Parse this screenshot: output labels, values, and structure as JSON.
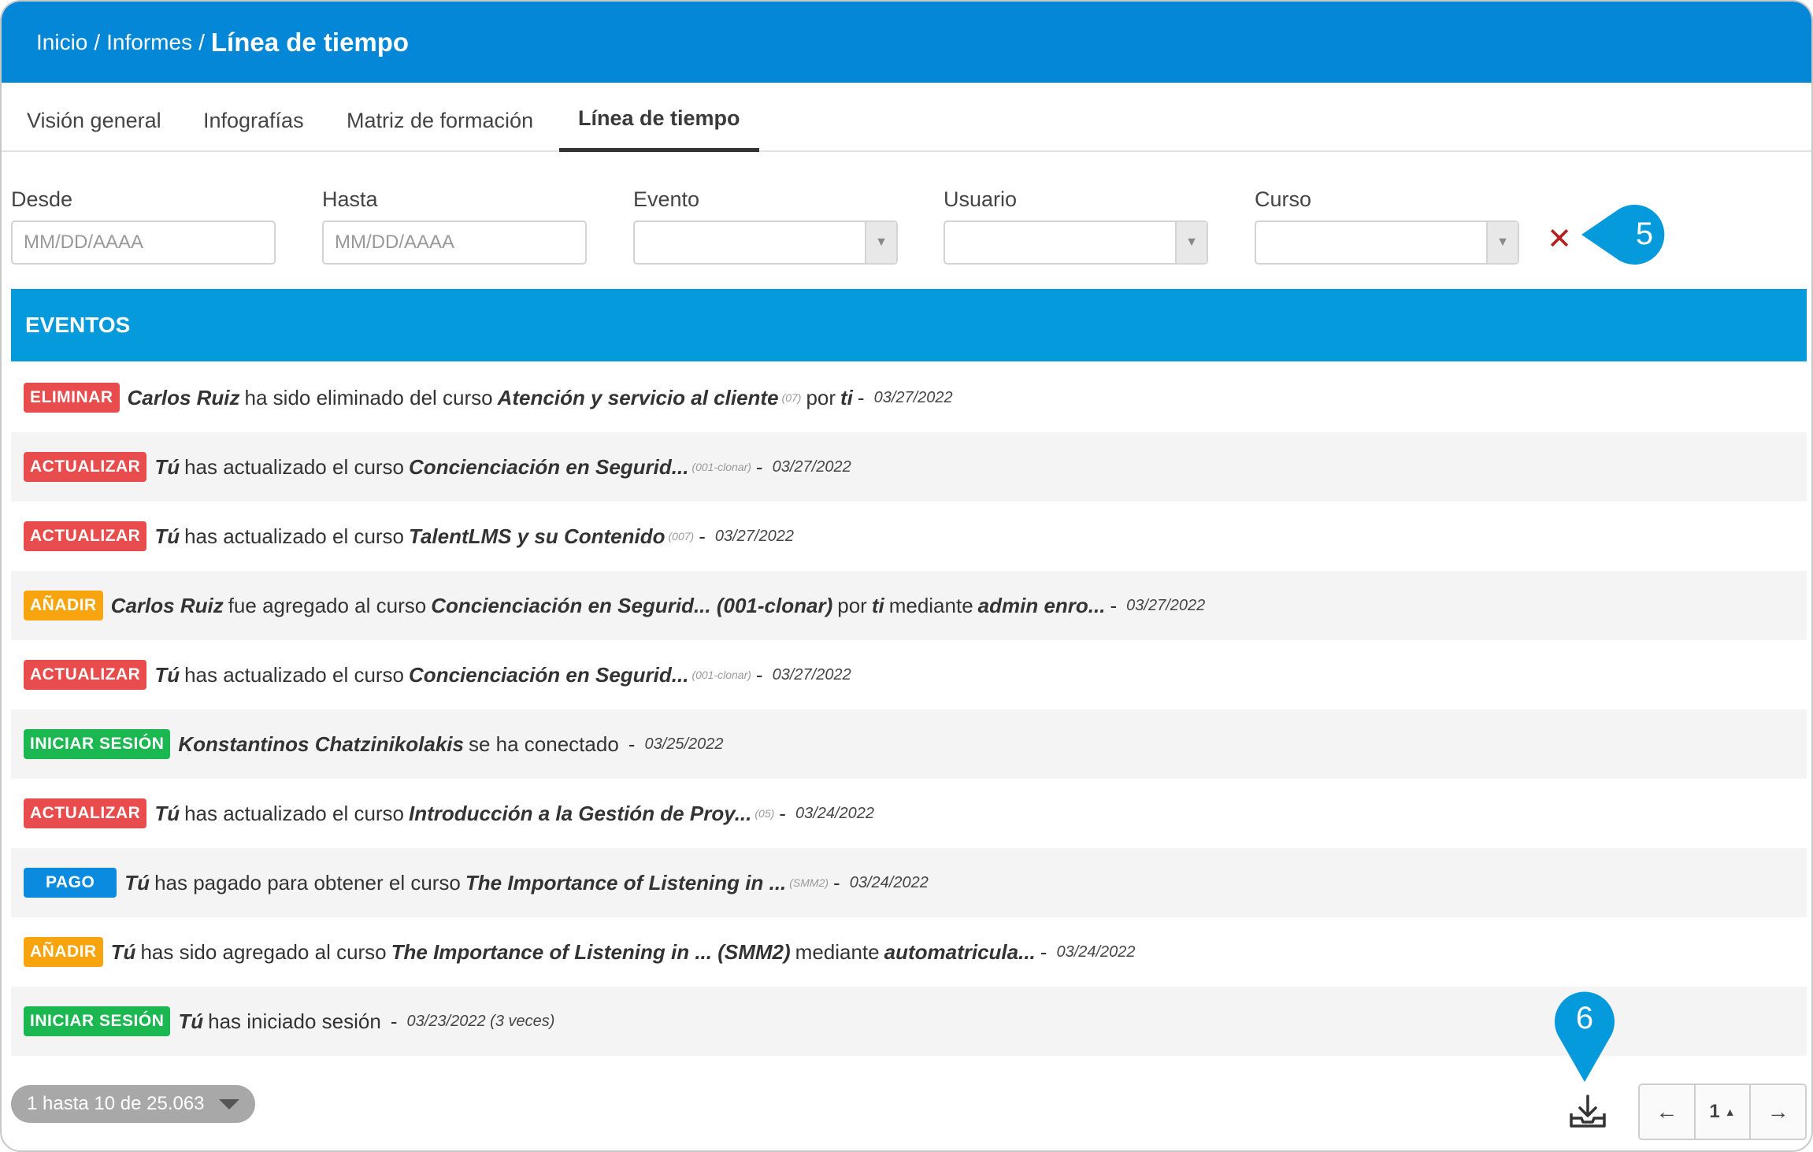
{
  "breadcrumb": {
    "home": "Inicio",
    "section": "Informes",
    "current": "Línea de tiempo",
    "separator": "/"
  },
  "tabs": [
    {
      "label": "Visión general",
      "active": false
    },
    {
      "label": "Infografías",
      "active": false
    },
    {
      "label": "Matriz de formación",
      "active": false
    },
    {
      "label": "Línea de tiempo",
      "active": true
    }
  ],
  "filters": {
    "from": {
      "label": "Desde",
      "placeholder": "MM/DD/AAAA"
    },
    "to": {
      "label": "Hasta",
      "placeholder": "MM/DD/AAAA"
    },
    "event": {
      "label": "Evento",
      "value": ""
    },
    "user": {
      "label": "Usuario",
      "value": ""
    },
    "course": {
      "label": "Curso",
      "value": ""
    },
    "clear_symbol": "✕"
  },
  "callouts": {
    "c5": "5",
    "c6": "6"
  },
  "events": {
    "title": "EVENTOS",
    "rows": [
      {
        "badge": "ELIMINAR",
        "color": "#e84c4c",
        "parts": [
          {
            "t": "name",
            "v": "Carlos Ruiz"
          },
          {
            "t": "txt",
            "v": "ha sido eliminado del curso"
          },
          {
            "t": "name",
            "v": "Atención y servicio al cliente"
          },
          {
            "t": "code",
            "v": "(07)"
          },
          {
            "t": "txt",
            "v": "por"
          },
          {
            "t": "name",
            "v": "ti"
          },
          {
            "t": "txt",
            "v": "-"
          },
          {
            "t": "date",
            "v": "03/27/2022"
          }
        ]
      },
      {
        "badge": "ACTUALIZAR",
        "color": "#e84c4c",
        "parts": [
          {
            "t": "name",
            "v": "Tú"
          },
          {
            "t": "txt",
            "v": "has actualizado el curso"
          },
          {
            "t": "name",
            "v": "Concienciación en Segurid..."
          },
          {
            "t": "code",
            "v": "(001-clonar)"
          },
          {
            "t": "txt",
            "v": "-"
          },
          {
            "t": "date",
            "v": "03/27/2022"
          }
        ]
      },
      {
        "badge": "ACTUALIZAR",
        "color": "#e84c4c",
        "parts": [
          {
            "t": "name",
            "v": "Tú"
          },
          {
            "t": "txt",
            "v": "has actualizado el curso"
          },
          {
            "t": "name",
            "v": "TalentLMS y su Contenido"
          },
          {
            "t": "code",
            "v": "(007)"
          },
          {
            "t": "txt",
            "v": "-"
          },
          {
            "t": "date",
            "v": "03/27/2022"
          }
        ]
      },
      {
        "badge": "AÑADIR",
        "color": "#f7a40e",
        "parts": [
          {
            "t": "name",
            "v": "Carlos Ruiz"
          },
          {
            "t": "txt",
            "v": "fue agregado al curso"
          },
          {
            "t": "name",
            "v": "Concienciación en Segurid... (001-clonar)"
          },
          {
            "t": "txt",
            "v": "por"
          },
          {
            "t": "name",
            "v": "ti"
          },
          {
            "t": "txt",
            "v": "mediante"
          },
          {
            "t": "name",
            "v": "admin enro..."
          },
          {
            "t": "txt",
            "v": "-"
          },
          {
            "t": "date",
            "v": "03/27/2022"
          }
        ]
      },
      {
        "badge": "ACTUALIZAR",
        "color": "#e84c4c",
        "parts": [
          {
            "t": "name",
            "v": "Tú"
          },
          {
            "t": "txt",
            "v": "has actualizado el curso"
          },
          {
            "t": "name",
            "v": "Concienciación en Segurid..."
          },
          {
            "t": "code",
            "v": "(001-clonar)"
          },
          {
            "t": "txt",
            "v": "-"
          },
          {
            "t": "date",
            "v": "03/27/2022"
          }
        ]
      },
      {
        "badge": "INICIAR SESIÓN",
        "color": "#1bb751",
        "parts": [
          {
            "t": "name",
            "v": "Konstantinos Chatzinikolakis"
          },
          {
            "t": "txt",
            "v": "se ha conectado"
          },
          {
            "t": "txt",
            "v": "-"
          },
          {
            "t": "date",
            "v": "03/25/2022"
          }
        ]
      },
      {
        "badge": "ACTUALIZAR",
        "color": "#e84c4c",
        "parts": [
          {
            "t": "name",
            "v": "Tú"
          },
          {
            "t": "txt",
            "v": "has actualizado el curso"
          },
          {
            "t": "name",
            "v": "Introducción a la Gestión de Proy..."
          },
          {
            "t": "code",
            "v": "(05)"
          },
          {
            "t": "txt",
            "v": "-"
          },
          {
            "t": "date",
            "v": "03/24/2022"
          }
        ]
      },
      {
        "badge": "PAGO",
        "color": "#0a8be0",
        "parts": [
          {
            "t": "name",
            "v": "Tú"
          },
          {
            "t": "txt",
            "v": "has pagado para obtener el curso"
          },
          {
            "t": "name",
            "v": "The Importance of Listening in ..."
          },
          {
            "t": "code",
            "v": "(SMM2)"
          },
          {
            "t": "txt",
            "v": "-"
          },
          {
            "t": "date",
            "v": "03/24/2022"
          }
        ]
      },
      {
        "badge": "AÑADIR",
        "color": "#f7a40e",
        "parts": [
          {
            "t": "name",
            "v": "Tú"
          },
          {
            "t": "txt",
            "v": "has sido agregado al curso"
          },
          {
            "t": "name",
            "v": "The Importance of Listening in ... (SMM2)"
          },
          {
            "t": "txt",
            "v": "mediante"
          },
          {
            "t": "name",
            "v": "automatricula..."
          },
          {
            "t": "txt",
            "v": "-"
          },
          {
            "t": "date",
            "v": "03/24/2022"
          }
        ]
      },
      {
        "badge": "INICIAR SESIÓN",
        "color": "#1bb751",
        "parts": [
          {
            "t": "name",
            "v": "Tú"
          },
          {
            "t": "txt",
            "v": "has iniciado sesión"
          },
          {
            "t": "txt",
            "v": "-"
          },
          {
            "t": "date",
            "v": "03/23/2022 (3 veces)"
          }
        ]
      }
    ]
  },
  "pagination": {
    "info": "1 hasta 10 de 25.063",
    "prev": "←",
    "current": "1",
    "next": "→"
  }
}
